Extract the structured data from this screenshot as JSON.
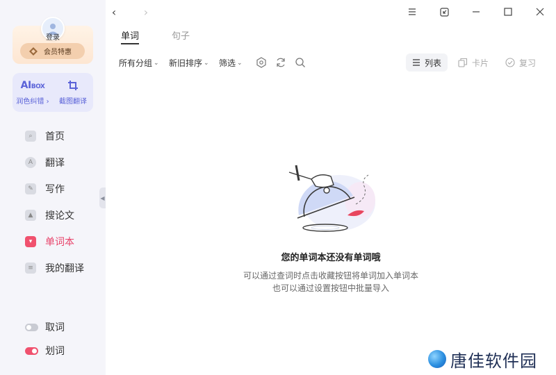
{
  "sidebar": {
    "login_label": "登录",
    "vip_label": "会员特惠",
    "tools": [
      {
        "logo_main": "AI",
        "logo_sub": "BOX",
        "label": "润色纠错"
      },
      {
        "label": "截图翻译"
      }
    ],
    "nav": [
      {
        "label": "首页",
        "icon": "home-icon"
      },
      {
        "label": "翻译",
        "icon": "translate-icon"
      },
      {
        "label": "写作",
        "icon": "pen-icon"
      },
      {
        "label": "搜论文",
        "icon": "mortarboard-icon"
      },
      {
        "label": "单词本",
        "icon": "bookmark-book-icon",
        "active": true
      },
      {
        "label": "我的翻译",
        "icon": "document-icon"
      }
    ],
    "bottom": [
      {
        "label": "取词",
        "on": false
      },
      {
        "label": "划词",
        "on": true
      }
    ]
  },
  "titlebar": {
    "back": "‹",
    "forward": "›"
  },
  "tabs": [
    {
      "label": "单词",
      "active": true
    },
    {
      "label": "句子",
      "active": false
    }
  ],
  "toolbar": {
    "filters": [
      {
        "label": "所有分组"
      },
      {
        "label": "新旧排序"
      },
      {
        "label": "筛选"
      }
    ],
    "views": [
      {
        "label": "列表",
        "active": true
      },
      {
        "label": "卡片",
        "active": false
      },
      {
        "label": "复习",
        "active": false
      }
    ]
  },
  "empty_state": {
    "title": "您的单词本还没有单词哦",
    "line1": "可以通过查词时点击收藏按钮将单词加入单词本",
    "line2": "也可以通过设置按钮中批量导入"
  },
  "watermark": {
    "text": "唐佳软件园"
  },
  "colors": {
    "accent": "#f0516e",
    "ai_purple": "#5a62d8",
    "sidebar_bg": "#f5f5fa"
  }
}
